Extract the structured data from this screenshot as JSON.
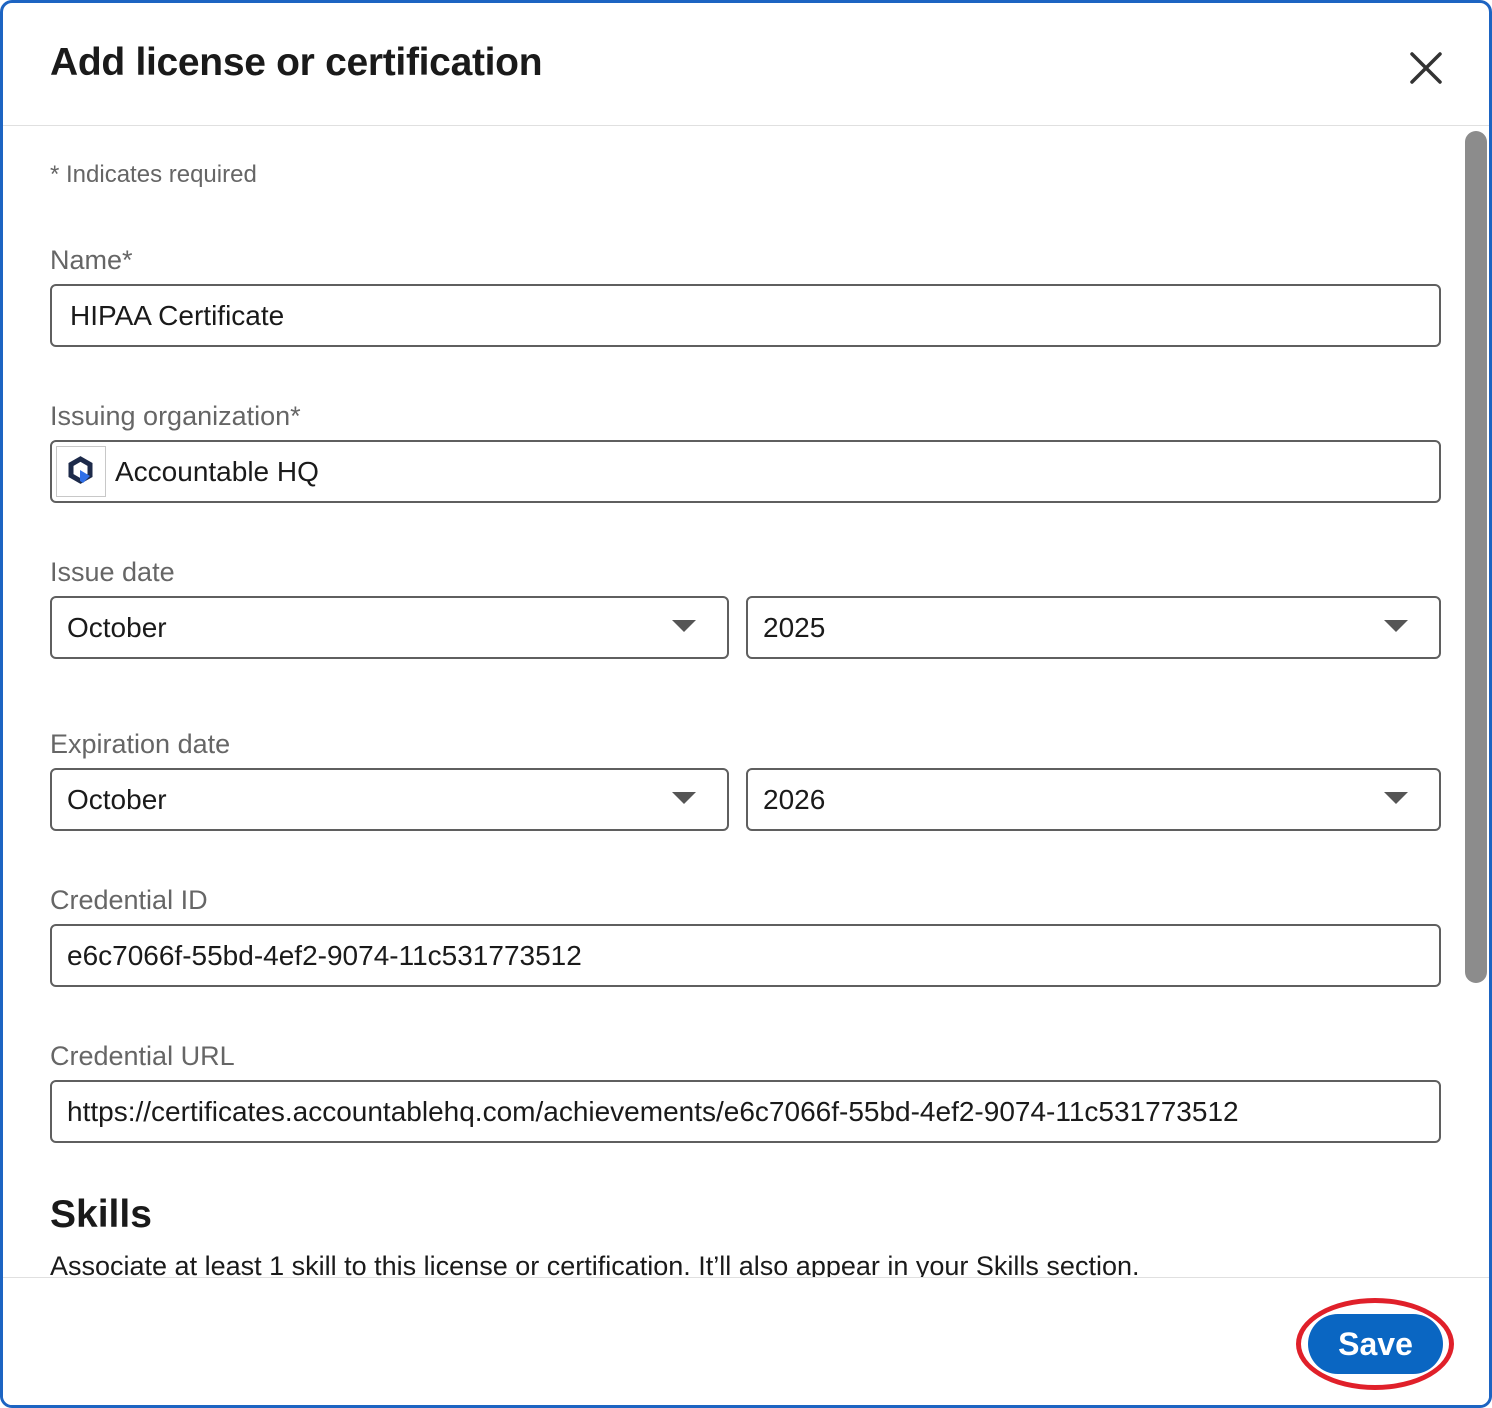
{
  "dialog": {
    "title": "Add license or certification",
    "required_note": "* Indicates required"
  },
  "fields": {
    "name": {
      "label": "Name*",
      "value": "HIPAA Certificate"
    },
    "issuing_org": {
      "label": "Issuing organization*",
      "value": "Accountable HQ",
      "logo_icon": "accountable-hq-logo"
    },
    "issue_date": {
      "label": "Issue date",
      "month": "October",
      "year": "2025"
    },
    "expiration_date": {
      "label": "Expiration date",
      "month": "October",
      "year": "2026"
    },
    "credential_id": {
      "label": "Credential ID",
      "value": "e6c7066f-55bd-4ef2-9074-11c531773512"
    },
    "credential_url": {
      "label": "Credential URL",
      "value": "https://certificates.accountablehq.com/achievements/e6c7066f-55bd-4ef2-9074-11c531773512"
    }
  },
  "skills": {
    "title": "Skills",
    "description": "Associate at least 1 skill to this license or certification. It’ll also appear in your Skills section."
  },
  "footer": {
    "save_label": "Save"
  },
  "colors": {
    "dialog_border": "#1d64c2",
    "primary_button": "#0a66c2",
    "highlight_ring": "#e0202a"
  }
}
